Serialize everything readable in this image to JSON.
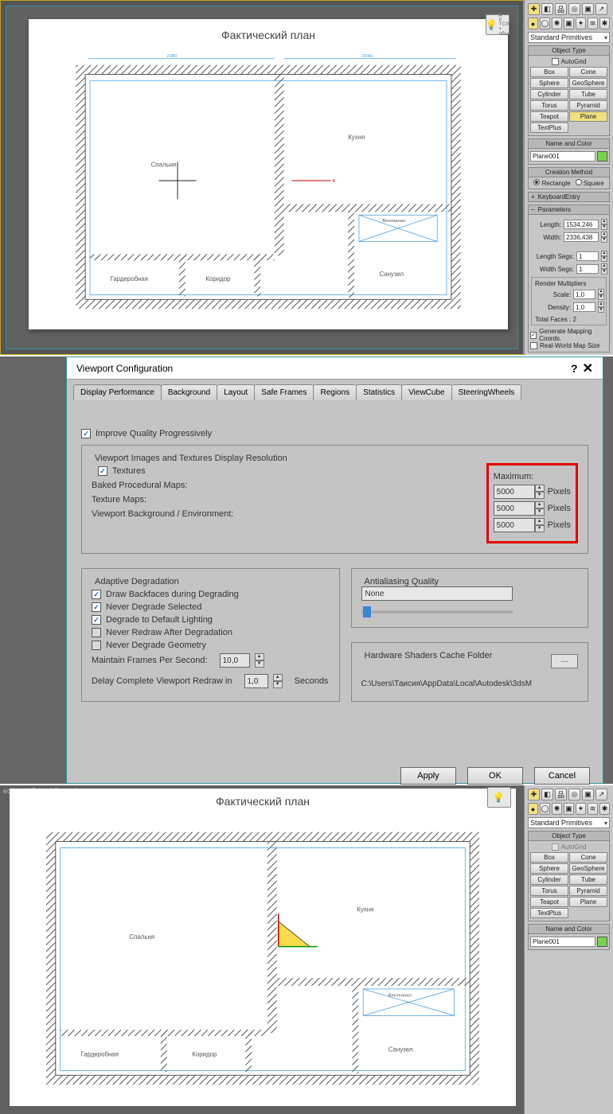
{
  "top": {
    "plan_title": "Фактический план",
    "rooms": {
      "bedroom": "Спальня",
      "kitchen": "Кухня",
      "closet": "Гардеробная",
      "corridor": "Коридор",
      "bathroom": "Санузел",
      "vent": "Вентканал"
    },
    "lightbulb_text": "Д + я\nТСЭ +\nобъе"
  },
  "panel": {
    "dropdown": "Standard Primitives",
    "object_type": "Object Type",
    "autogrid": "AutoGrid",
    "buttons": {
      "box": "Box",
      "cone": "Cone",
      "sphere": "Sphere",
      "geosphere": "GeoSphere",
      "cylinder": "Cylinder",
      "tube": "Tube",
      "torus": "Torus",
      "pyramid": "Pyramid",
      "teapot": "Teapot",
      "plane": "Plane",
      "textplus": "TextPlus"
    },
    "name_and_color": "Name and Color",
    "object_name": "Plane001",
    "creation_method": "Creation Method",
    "rectangle": "Rectangle",
    "square": "Square",
    "keyboard_entry": "KeyboardEntry",
    "parameters": "Parameters",
    "length_lbl": "Length:",
    "length_val": "1534,246",
    "width_lbl": "Width:",
    "width_val": "2336,438",
    "lsegs_lbl": "Length Segs:",
    "lsegs_val": "1",
    "wsegs_lbl": "Width Segs:",
    "wsegs_val": "1",
    "render_mult": "Render Multipliers",
    "scale_lbl": "Scale:",
    "scale_val": "1,0",
    "density_lbl": "Density:",
    "density_val": "1,0",
    "total_faces": "Total Faces : 2",
    "gen_mapping": "Generate Mapping Coords.",
    "real_world": "Real-World Map Size"
  },
  "dialog": {
    "title": "Viewport Configuration",
    "tabs": [
      "Display Performance",
      "Background",
      "Layout",
      "Safe Frames",
      "Regions",
      "Statistics",
      "ViewCube",
      "SteeringWheels"
    ],
    "improve": "Improve Quality Progressively",
    "res_group": "Viewport Images and Textures Display Resolution",
    "textures": "Textures",
    "maximum": "Maximum:",
    "baked": "Baked Procedural Maps:",
    "texmaps": "Texture Maps:",
    "vpbg": "Viewport Background / Environment:",
    "px": "Pixels",
    "vals": {
      "baked": "5000",
      "tex": "5000",
      "bg": "5000"
    },
    "deg_group": "Adaptive Degradation",
    "draw_bf": "Draw Backfaces during Degrading",
    "never_sel": "Never Degrade Selected",
    "deg_default": "Degrade to Default Lighting",
    "never_redraw": "Never Redraw After Degradation",
    "never_geom": "Never Degrade Geometry",
    "maintain": "Maintain Frames Per Second:",
    "maintain_v": "10,0",
    "delay": "Delay Complete Viewport Redraw in",
    "delay_v": "1,0",
    "seconds": "Seconds",
    "aa_group": "Antialiasing Quality",
    "aa_mode": "None",
    "hw_group": "Hardware Shaders Cache Folder",
    "hw_path": "C:\\Users\\Таисия\\AppData\\Local\\Autodesk\\3dsM",
    "apply": "Apply",
    "ok": "OK",
    "cancel": "Cancel"
  },
  "bottom": {
    "caption": "ectiv... » Edged Faces ]",
    "plan_title": "Фактический план",
    "rooms": {
      "bedroom": "Спальня",
      "kitchen": "Кухня",
      "closet": "Гардеробная",
      "corridor": "Коридор",
      "bathroom": "Санузел",
      "vent": "Вентканал"
    }
  },
  "panel2": {
    "dropdown": "Standard Primitives",
    "object_type": "Object Type",
    "autogrid": "AutoGrid",
    "name_and_color": "Name and Color",
    "object_name": "Plane001"
  }
}
